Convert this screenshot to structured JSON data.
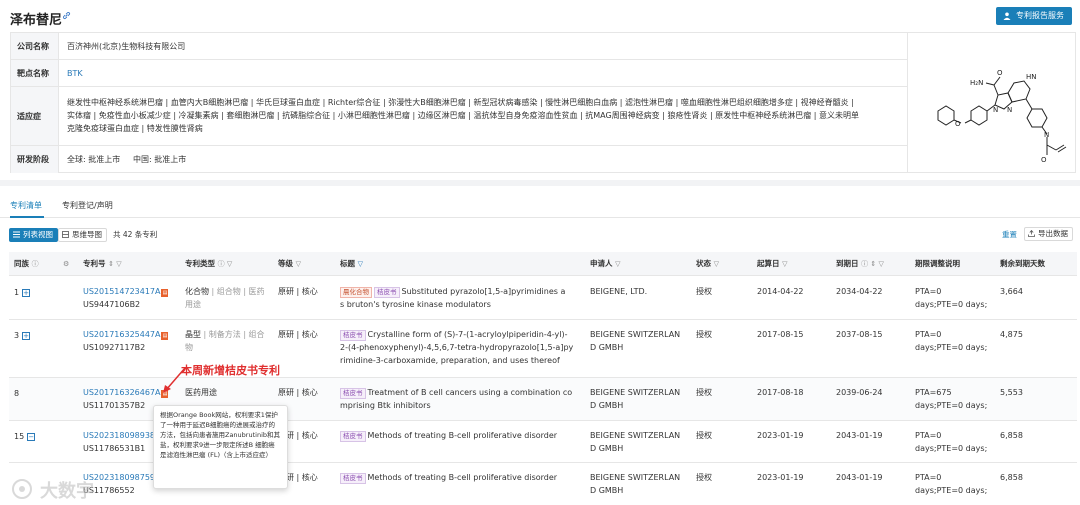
{
  "header": {
    "title": "泽布替尼",
    "service_button": "专利报告服务"
  },
  "info": {
    "company_label": "公司名称",
    "company_value": "百济神州(北京)生物科技有限公司",
    "target_label": "靶点名称",
    "target_value": "BTK",
    "indication_label": "适应症",
    "indication_line1": "继发性中枢神经系统淋巴瘤 | 血管内大B细胞淋巴瘤 | 华氏巨球蛋白血症 | Richter综合征 | 弥漫性大B细胞淋巴瘤 | 新型冠状病毒感染 | 慢性淋巴细胞白血病 | 滤泡性淋巴瘤 | 噬血细胞性淋巴组织细胞增多症 | 视神经脊髓炎 |",
    "indication_line2": "实体瘤 | 免疫性血小板减少症 | 冷凝集素病 | 套细胞淋巴瘤 | 抗磷脂综合征 | 小淋巴细胞性淋巴瘤 | 边缘区淋巴瘤 | 温抗体型自身免疫溶血性贫血 | 抗MAG周围神经病变 | 狼疮性肾炎 | 原发性中枢神经系统淋巴瘤 | 意义未明单",
    "indication_line3": "克隆免疫球蛋白血症 | 特发性膜性肾病",
    "phase_label": "研发阶段",
    "phase_value": "全球: 批准上市     中国: 批准上市"
  },
  "structure": {
    "label_nh2": "H₂N",
    "label_o1": "O",
    "label_o2": "O",
    "label_o3": "O",
    "label_n1": "N",
    "label_n2": "N",
    "label_n3": "N",
    "label_nh": "HN"
  },
  "tabs": {
    "tab1": "专利清单",
    "tab2": "专利登记/声明"
  },
  "toolbar": {
    "list_view": "列表视图",
    "mind_map": "思维导图",
    "count": "共 42 条专利",
    "reset": "重置",
    "export": "导出数据"
  },
  "table": {
    "headers": {
      "family": "同族",
      "patent_no": "专利号",
      "type": "专利类型",
      "level": "等级",
      "title": "标题",
      "applicant": "申请人",
      "status": "状态",
      "start": "起算日",
      "expiry": "到期日",
      "adjust": "期限调整说明",
      "remaining": "剩余到期天数"
    },
    "rows": [
      {
        "family": "1",
        "pn1": "US201514723417A",
        "pn2": "US9447106B2",
        "type_line1": "化合物",
        "type_line1_muted": " | 组合物 | 医药",
        "type_line2_muted": "用途",
        "level": "原研 | 核心",
        "tags": [
          "晨化合物",
          "桔皮书"
        ],
        "title_line1": "Substituted pyrazolo[1,5-a]pyrimidines a",
        "title_line2": "s bruton's tyrosine kinase modulators",
        "applicant_line1": "BEIGENE, LTD.",
        "applicant_line2": "",
        "status": "授权",
        "start": "2014-04-22",
        "expiry": "2034-04-22",
        "adjust_line1": "PTA=0",
        "adjust_line2": "days;PTE=0 days;",
        "remaining": "3,664"
      },
      {
        "family": "3",
        "pn1": "US201716325447A",
        "pn2": "US10927117B2",
        "type_line1": "晶型",
        "type_line1_muted": " | 制备方法 | 组合",
        "type_line2_muted": "物",
        "level": "原研 | 核心",
        "tags": [
          "桔皮书"
        ],
        "title_line1": "Crystalline form of (S)-7-(1-acryloylpiperidin-4-yl)-",
        "title_line2": "2-(4-phenoxyphenyl)-4,5,6,7-tetra-hydropyrazolo[1,5-a]py",
        "title_line3": "rimidine-3-carboxamide, preparation, and uses thereof",
        "applicant_line1": "BEIGENE SWITZERLAN",
        "applicant_line2": "D GMBH",
        "status": "授权",
        "start": "2017-08-15",
        "expiry": "2037-08-15",
        "adjust_line1": "PTA=0",
        "adjust_line2": "days;PTE=0 days;",
        "remaining": "4,875"
      },
      {
        "family": "8",
        "pn1": "US201716326467A",
        "pn2": "US11701357B2",
        "type_line1": "医药用途",
        "type_line1_muted": "",
        "type_line2_muted": "",
        "level": "原研 | 核心",
        "tags": [
          "桔皮书"
        ],
        "title_line1": "Treatment of B cell cancers using a combination co",
        "title_line2": "mprising Btk inhibitors",
        "applicant_line1": "BEIGENE SWITZERLAN",
        "applicant_line2": "D GMBH",
        "status": "授权",
        "start": "2017-08-18",
        "expiry": "2039-06-24",
        "adjust_line1": "PTA=675",
        "adjust_line2": "days;PTE=0 days;",
        "remaining": "5,553"
      },
      {
        "family": "15",
        "pn1": "US202318098938",
        "pn2": "US11786531B1",
        "level": "原研 | 核心",
        "tags": [
          "桔皮书"
        ],
        "title_line1": "Methods of treating B-cell proliferative disorder",
        "applicant_line1": "BEIGENE SWITZERLAN",
        "applicant_line2": "D GMBH",
        "status": "授权",
        "start": "2023-01-19",
        "expiry": "2043-01-19",
        "adjust_line1": "PTA=0",
        "adjust_line2": "days;PTE=0 days;",
        "remaining": "6,858"
      },
      {
        "family": "",
        "pn1": "US2023180987591",
        "pn2": "US11786552",
        "level": "原研 | 核心",
        "tags": [
          "桔皮书"
        ],
        "title_line1": "Methods of treating B-cell proliferative disorder",
        "applicant_line1": "BEIGENE SWITZERLAN",
        "applicant_line2": "D GMBH",
        "status": "授权",
        "start": "2023-01-19",
        "expiry": "2043-01-19",
        "adjust_line1": "PTA=0",
        "adjust_line2": "days;PTE=0 days;",
        "remaining": "6,858"
      }
    ]
  },
  "annotation": "本周新增桔皮书专利",
  "tooltip": "根据Orange Book网站，权利要求1保护了一种用于延迟B细胞癌的进展或治疗的方法，包括向患者施用Zanubrutinib和其盐，权利要求9进一步限定所述B 细胞癌是滤泡性淋巴瘤 (FL)（含上市适应症）",
  "watermark": "大数字"
}
